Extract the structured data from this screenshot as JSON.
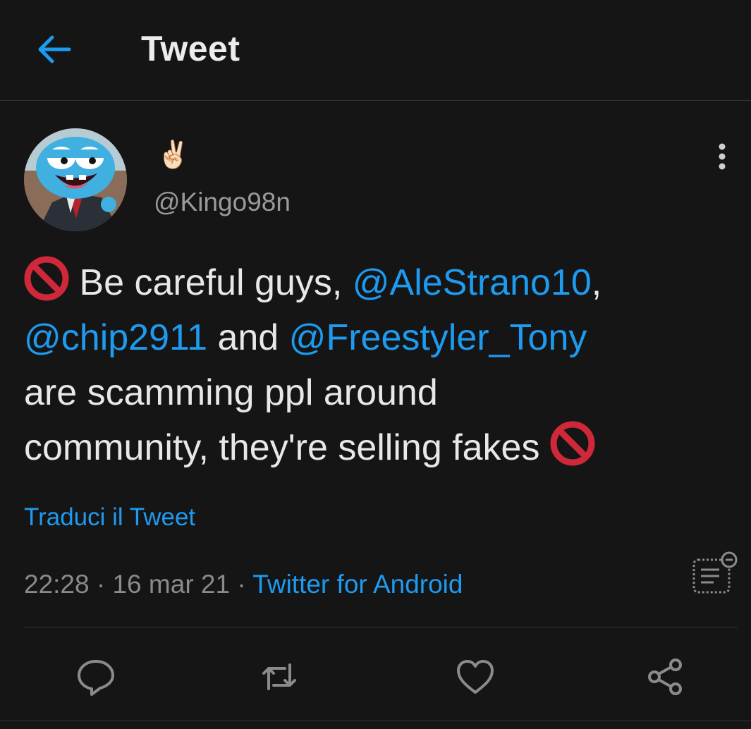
{
  "header": {
    "title": "Tweet"
  },
  "author": {
    "display_name": "✌🏻",
    "handle": "@Kingo98n",
    "avatar_desc": "avatar"
  },
  "tweet": {
    "emoji": "no-entry-sign",
    "line1_text": " Be careful guys, ",
    "mention1": "@AleStrano10",
    "line1_end": ",",
    "mention2": "@chip2911",
    "line2_mid": " and ",
    "mention3": "@Freestyler_Tony",
    "line3_text": "are scamming ppl around",
    "line4_text": "community, they're selling fakes "
  },
  "translate_label": "Traduci il Tweet",
  "meta": {
    "time": "22:28",
    "sep1": " · ",
    "date": "16 mar 21",
    "sep2": " · ",
    "source": "Twitter for Android"
  },
  "actions": {
    "reply": "reply-icon",
    "retweet": "retweet-icon",
    "like": "heart-icon",
    "share": "share-icon"
  },
  "colors": {
    "background": "#151515",
    "accent": "#1d9bf0",
    "text": "#e8e8e8",
    "muted": "#8b8b8b",
    "no_entry": "#d0283b"
  }
}
